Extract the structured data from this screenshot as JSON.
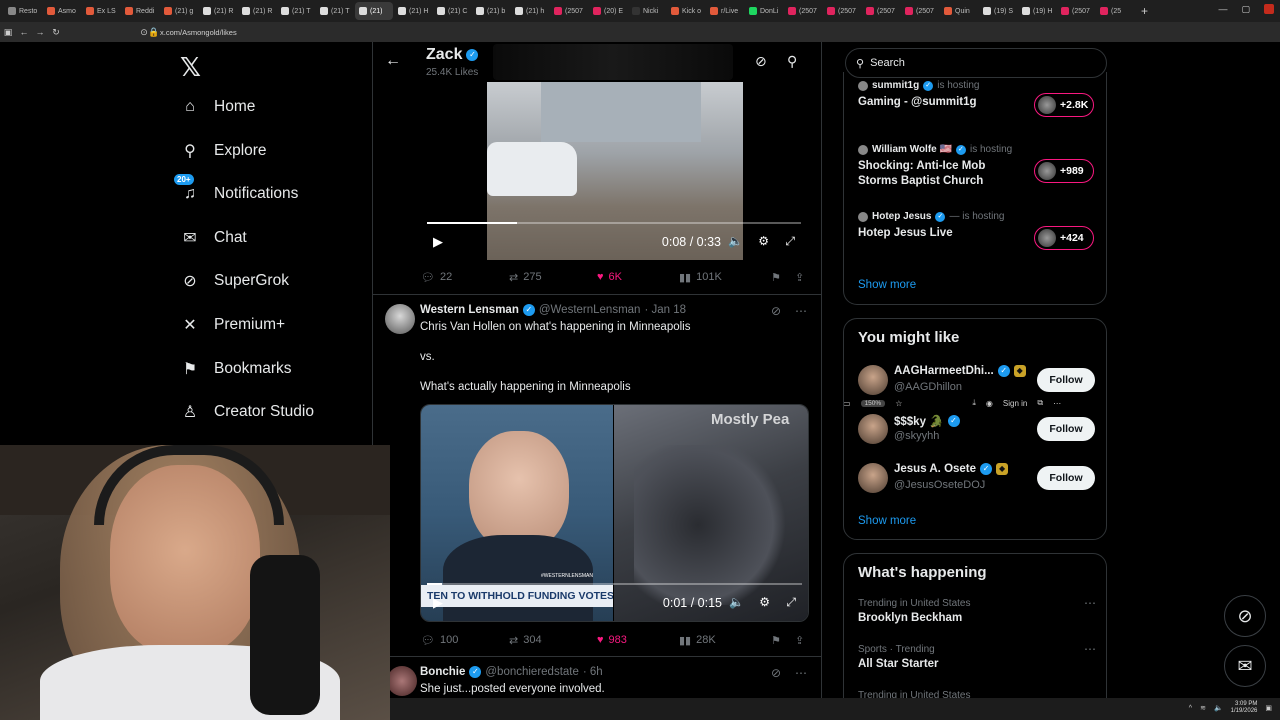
{
  "browser": {
    "tabs": [
      {
        "label": "Resto",
        "color": "#888888",
        "active": false
      },
      {
        "label": "Asmo",
        "color": "#e25a3b",
        "active": false
      },
      {
        "label": "Ex LS",
        "color": "#e25a3b",
        "active": false
      },
      {
        "label": "Reddi",
        "color": "#e25a3b",
        "active": false
      },
      {
        "label": "(21) g",
        "color": "#e25a3b",
        "active": false
      },
      {
        "label": "(21) R",
        "color": "#dddddd",
        "active": false
      },
      {
        "label": "(21) R",
        "color": "#dddddd",
        "active": false
      },
      {
        "label": "(21) T",
        "color": "#dddddd",
        "active": false
      },
      {
        "label": "(21) T",
        "color": "#dddddd",
        "active": false
      },
      {
        "label": "(21)",
        "color": "#dddddd",
        "active": true
      },
      {
        "label": "(21) H",
        "color": "#dddddd",
        "active": false
      },
      {
        "label": "(21) C",
        "color": "#dddddd",
        "active": false
      },
      {
        "label": "(21) b",
        "color": "#dddddd",
        "active": false
      },
      {
        "label": "(21) h",
        "color": "#dddddd",
        "active": false
      },
      {
        "label": "(2507",
        "color": "#e0245e",
        "active": false
      },
      {
        "label": "(20) E",
        "color": "#e0245e",
        "active": false
      },
      {
        "label": "Nicki",
        "color": "#333333",
        "active": false
      },
      {
        "label": "Kick o",
        "color": "#e25a3b",
        "active": false
      },
      {
        "label": "r/Live",
        "color": "#e25a3b",
        "active": false
      },
      {
        "label": "DonLi",
        "color": "#1ed760",
        "active": false
      },
      {
        "label": "(2507",
        "color": "#e0245e",
        "active": false
      },
      {
        "label": "(2507",
        "color": "#e0245e",
        "active": false
      },
      {
        "label": "(2507",
        "color": "#e0245e",
        "active": false
      },
      {
        "label": "(2507",
        "color": "#e0245e",
        "active": false
      },
      {
        "label": "Quin",
        "color": "#e25a3b",
        "active": false
      },
      {
        "label": "(19) S",
        "color": "#dddddd",
        "active": false
      },
      {
        "label": "(19) H",
        "color": "#dddddd",
        "active": false
      },
      {
        "label": "(2507",
        "color": "#e0245e",
        "active": false
      },
      {
        "label": "(25",
        "color": "#e0245e",
        "active": false
      }
    ],
    "url": "x.com/Asmongold/likes",
    "zoom": "150%",
    "signin": "Sign in"
  },
  "nav": {
    "items": [
      {
        "label": "Home",
        "icon": "home-icon",
        "glyph": "⌂"
      },
      {
        "label": "Explore",
        "icon": "search-icon",
        "glyph": "⚲"
      },
      {
        "label": "Notifications",
        "icon": "bell-icon",
        "glyph": "♫"
      },
      {
        "label": "Chat",
        "icon": "mail-icon",
        "glyph": "✉"
      },
      {
        "label": "SuperGrok",
        "icon": "grok-icon",
        "glyph": "⊘"
      },
      {
        "label": "Premium+",
        "icon": "x-icon",
        "glyph": "✕"
      },
      {
        "label": "Bookmarks",
        "icon": "bookmark-icon",
        "glyph": "⚑"
      },
      {
        "label": "Creator Studio",
        "icon": "flask-icon",
        "glyph": "♙"
      }
    ],
    "notifications_badge": "20+"
  },
  "profile_header": {
    "name": "Zack",
    "likes": "25.4K Likes"
  },
  "tweet1": {
    "video_time": "0:08 / 0:33",
    "video_progress": 0.24,
    "replies": "22",
    "reposts": "275",
    "likes": "6K",
    "views": "101K"
  },
  "tweet2": {
    "author": "Western Lensman",
    "handle": "@WesternLensman",
    "date": "· Jan 18",
    "line1": "Chris Van Hollen on what's happening in Minneapolis",
    "line2": "vs.",
    "line3": "What's actually happening in Minneapolis",
    "chyron": "TEN TO WITHHOLD FUNDING VOTES OVER",
    "chyron_tag": "#WESTERNLENSMAN",
    "watermark": "Mostly Pea",
    "video_time": "0:01 / 0:15",
    "video_progress": 0.04,
    "replies": "100",
    "reposts": "304",
    "likes": "983",
    "views": "28K"
  },
  "tweet3": {
    "author": "Bonchie",
    "handle": "@bonchieredstate",
    "date": "· 6h",
    "text": "She just...posted everyone involved."
  },
  "search": {
    "placeholder": "Search"
  },
  "live": {
    "hosts": [
      {
        "host": "summit1g",
        "status": "is hosting",
        "title": "Gaming - @summit1g",
        "count": "+2.8K"
      },
      {
        "host": "William Wolfe 🇺🇸",
        "status": "is hosting",
        "title": "Shocking: Anti-Ice Mob\nStorms Baptist Church",
        "count": "+989"
      },
      {
        "host": "Hotep Jesus",
        "status": "— is hosting",
        "title": "Hotep Jesus Live",
        "count": "+424"
      }
    ],
    "show_more": "Show more"
  },
  "you_might_like": {
    "title": "You might like",
    "people": [
      {
        "name": "AAGHarmeetDhi...",
        "handle": "@AAGDhillon",
        "follow": "Follow"
      },
      {
        "name": "$$$ky 🐊",
        "handle": "@skyyhh",
        "follow": "Follow"
      },
      {
        "name": "Jesus A. Osete",
        "handle": "@JesusOseteDOJ",
        "follow": "Follow"
      }
    ],
    "show_more": "Show more"
  },
  "whats_happening": {
    "title": "What's happening",
    "trends": [
      {
        "meta": "Trending in United States",
        "name": "Brooklyn Beckham"
      },
      {
        "meta": "Sports · Trending",
        "name": "All Star Starter"
      },
      {
        "meta": "Trending in United States",
        "name": ""
      }
    ]
  },
  "taskbar": {
    "time": "3:09 PM",
    "date": "1/19/2026"
  }
}
